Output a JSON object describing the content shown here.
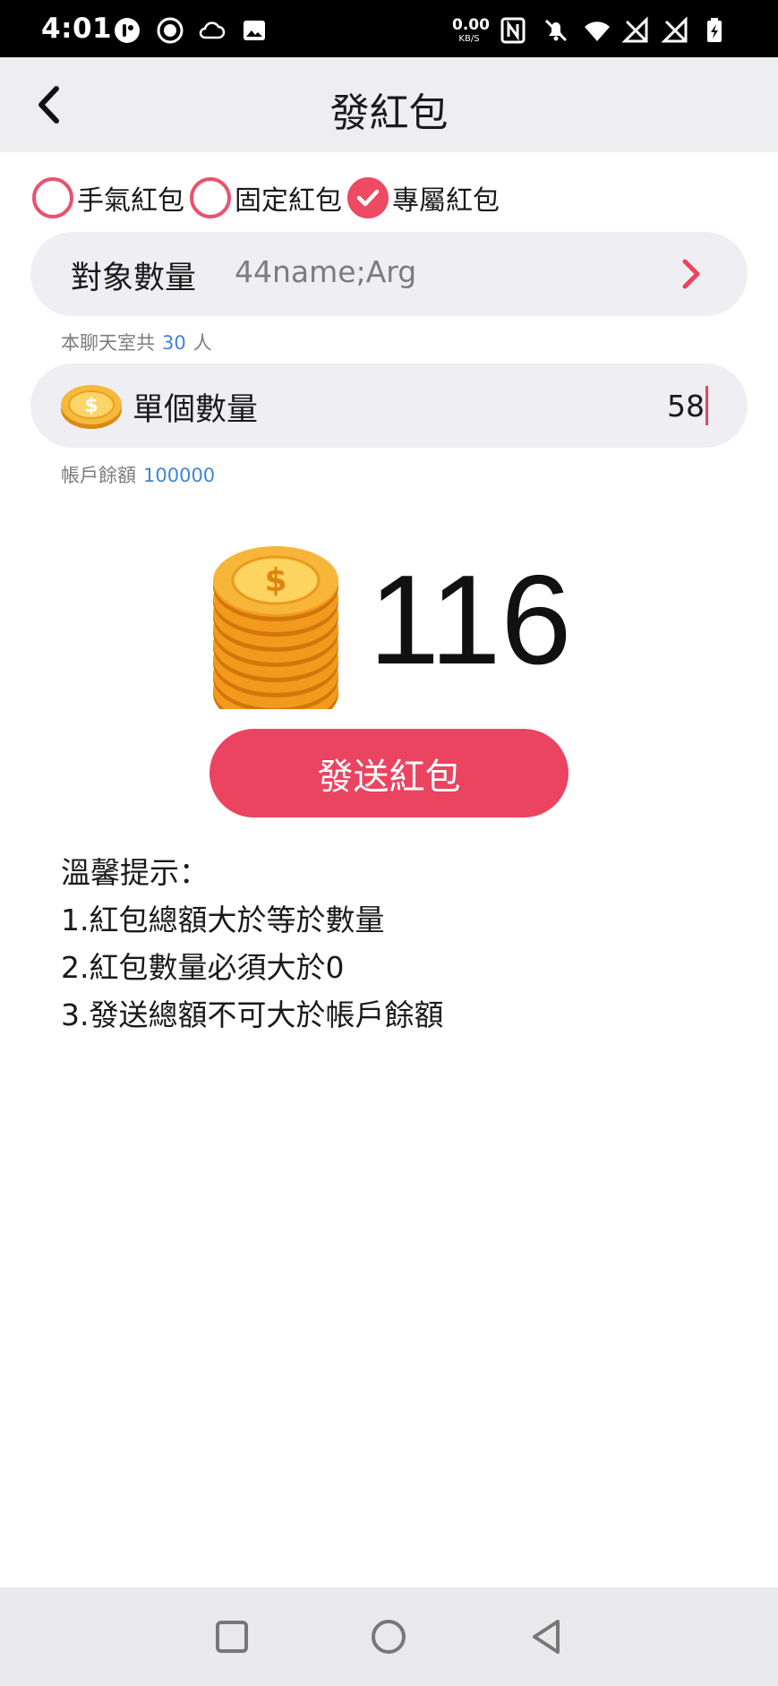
{
  "status_bar": {
    "time": "4:01",
    "net_speed_value": "0.00",
    "net_speed_unit": "KB/S"
  },
  "header": {
    "title": "發紅包",
    "back_icon": "chevron-left-icon"
  },
  "packet_types": [
    {
      "label": "手氣紅包",
      "checked": false
    },
    {
      "label": "固定紅包",
      "checked": false
    },
    {
      "label": "專屬紅包",
      "checked": true
    }
  ],
  "target_field": {
    "label": "對象數量",
    "value": "44name;Arg"
  },
  "member_hint": {
    "prefix": "本聊天室共",
    "count": "30",
    "suffix": "人"
  },
  "amount_field": {
    "label": "單個數量",
    "value": "58"
  },
  "balance_hint": {
    "label": "帳戶餘額",
    "value": "100000"
  },
  "total": {
    "value": "116"
  },
  "send_button": {
    "label": "發送紅包"
  },
  "tips": {
    "title": "溫馨提示：",
    "items": [
      "1.紅包總額大於等於數量",
      "2.紅包數量必須大於0",
      "3.發送總額不可大於帳戶餘額"
    ]
  },
  "colors": {
    "accent": "#ea4460",
    "link_blue": "#3f86d4",
    "field_bg": "#efeff3",
    "coin_gold": "#f0a020"
  }
}
